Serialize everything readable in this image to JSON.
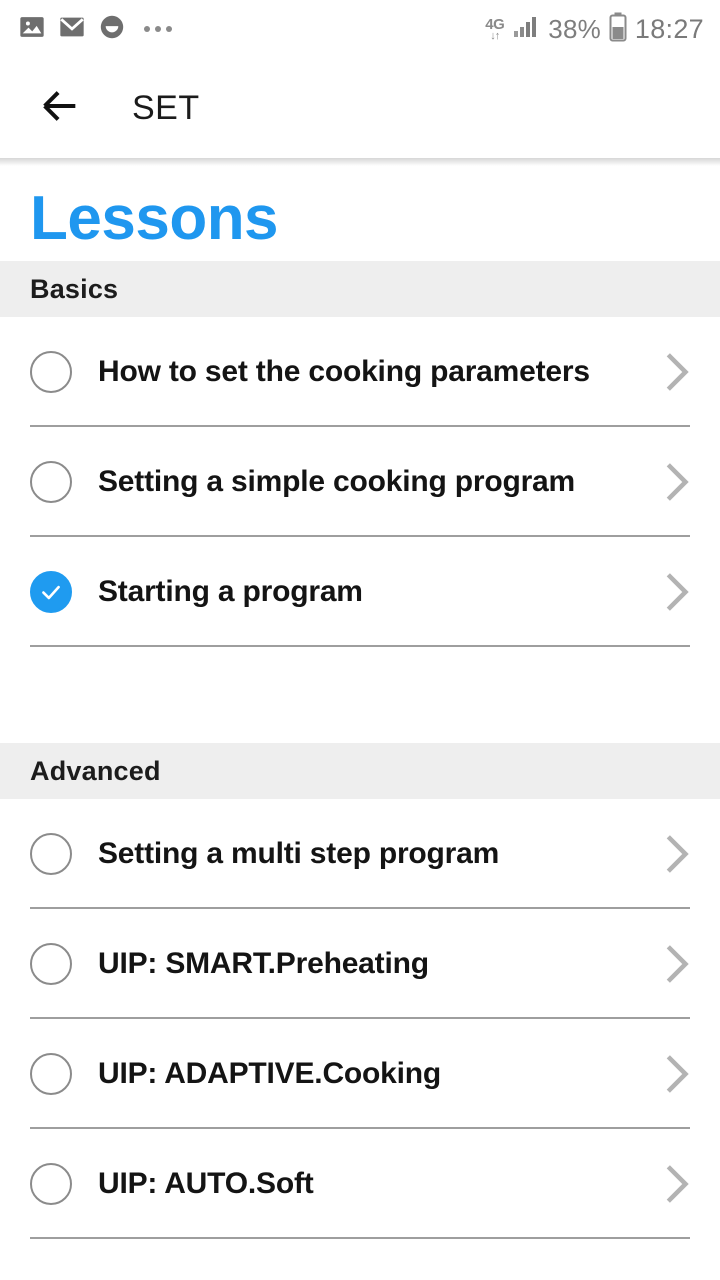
{
  "statusbar": {
    "left_icons": [
      {
        "name": "photo-icon"
      },
      {
        "name": "mail-icon"
      },
      {
        "name": "smiley-icon"
      },
      {
        "name": "more-icon"
      }
    ],
    "network_type": "4G",
    "network_arrows": "↓↑",
    "signal_icon": "signal-bars-icon",
    "battery_percent": "38%",
    "battery_icon": "battery-icon",
    "time": "18:27"
  },
  "appbar": {
    "back_icon": "back-arrow-icon",
    "title": "SET"
  },
  "page": {
    "title": "Lessons"
  },
  "sections": [
    {
      "header": "Basics",
      "items": [
        {
          "label": "How to set the cooking parameters",
          "completed": false
        },
        {
          "label": "Setting a simple cooking program",
          "completed": false
        },
        {
          "label": "Starting a program",
          "completed": true
        }
      ]
    },
    {
      "header": "Advanced",
      "items": [
        {
          "label": "Setting a multi step program",
          "completed": false
        },
        {
          "label": "UIP: SMART.Preheating",
          "completed": false
        },
        {
          "label": "UIP: ADAPTIVE.Cooking",
          "completed": false
        },
        {
          "label": "UIP: AUTO.Soft",
          "completed": false
        }
      ]
    }
  ],
  "colors": {
    "accent": "#1f97ef",
    "check_fill": "#1f9bf0",
    "section_band": "#eeeeee",
    "separator": "#9e9e9e",
    "chevron": "#b3b3b3"
  }
}
